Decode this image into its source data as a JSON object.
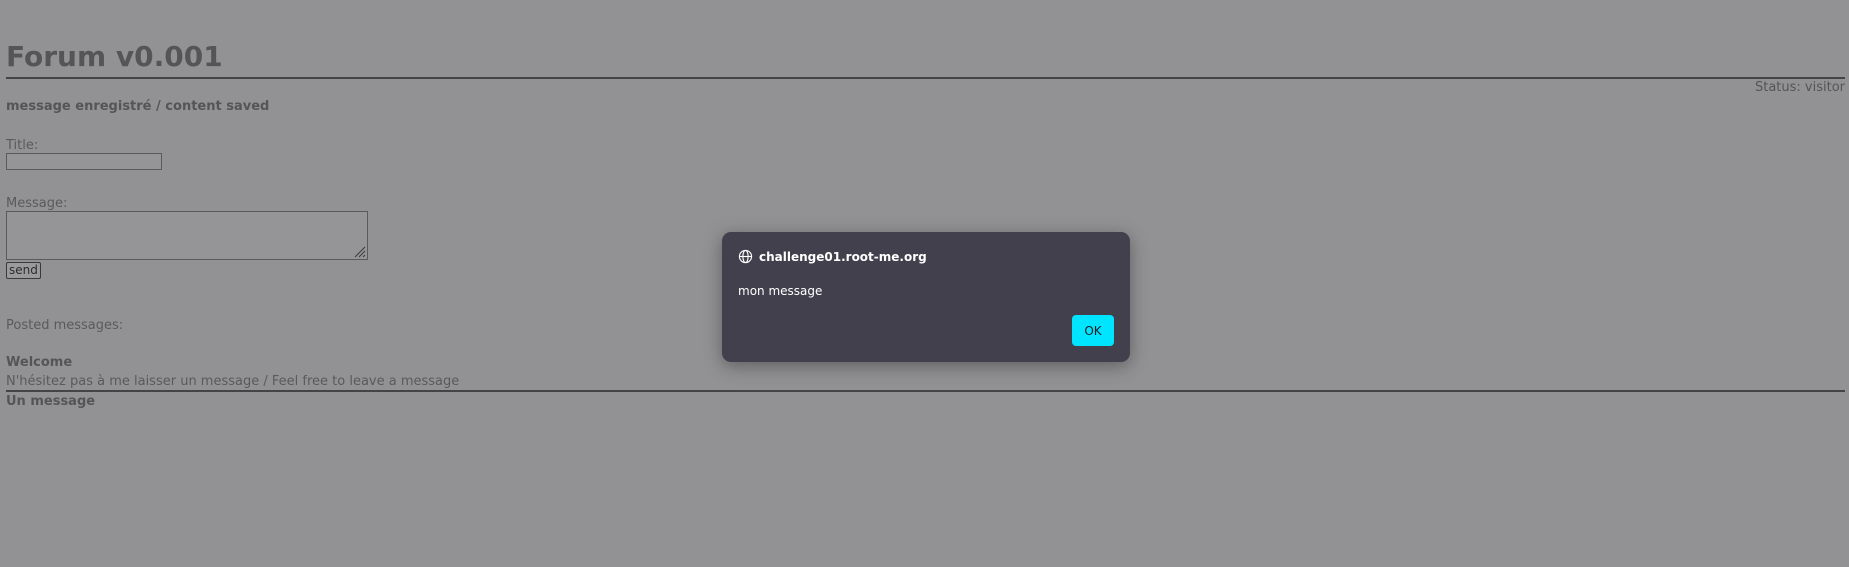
{
  "forum": {
    "title": "Forum v0.001",
    "status": "Status: visitor",
    "saved_notice": "message enregistré / content saved",
    "form": {
      "title_label": "Title:",
      "title_value": "",
      "message_label": "Message:",
      "message_value": "",
      "send_label": "send"
    },
    "posted_label": "Posted messages:",
    "posts": [
      {
        "title": "Welcome",
        "body": "N'hésitez pas à me laisser un message / Feel free to leave a message"
      },
      {
        "title": "Un message",
        "body": ""
      }
    ]
  },
  "dialog": {
    "origin": "challenge01.root-me.org",
    "message": "mon message",
    "ok_label": "OK",
    "icon": "globe-icon",
    "accent_color": "#00e5ff",
    "background_color": "#42404d"
  }
}
